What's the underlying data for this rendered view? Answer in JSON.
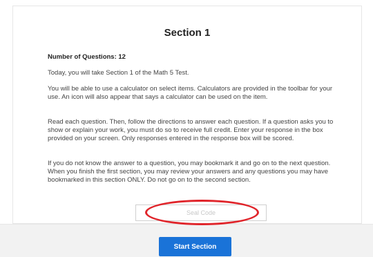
{
  "section": {
    "title": "Section 1",
    "question_count": "Number of Questions: 12",
    "paragraphs": [
      "Today, you will take Section 1 of the Math 5 Test.",
      "You will be able to use a calculator on select items. Calculators are provided in the toolbar for your use. An icon will also appear that says a calculator can be used on the item.",
      "Read each question. Then, follow the directions to answer each question. If a question asks you to show or explain your work, you must do so to receive full credit. Enter your response in the box provided on your screen. Only responses entered in the response box will be scored.",
      "If you do not know the answer to a question, you may bookmark it and go on to the next question. When you finish the first section, you may review your answers and any questions you may have bookmarked in this section ONLY. Do not go on to the second section."
    ]
  },
  "seal_code": {
    "placeholder": "Seal Code",
    "value": ""
  },
  "start_button": {
    "label": "Start Section"
  },
  "colors": {
    "highlight": "#e0242a",
    "button": "#1a73d8"
  }
}
